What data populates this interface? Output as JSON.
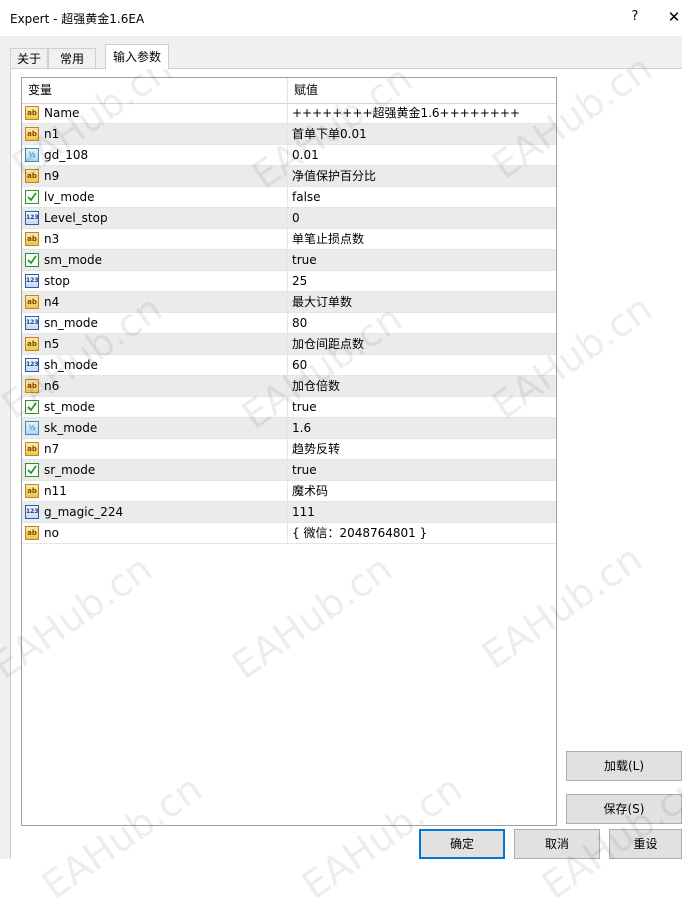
{
  "window": {
    "title": "Expert - 超强黄金1.6EA",
    "help_label": "?",
    "close_label": "✕"
  },
  "tabs": [
    {
      "label": "关于",
      "active": false
    },
    {
      "label": "常用",
      "active": false
    },
    {
      "label": "输入参数",
      "active": true
    }
  ],
  "grid": {
    "header_var": "变量",
    "header_val": "赋值",
    "rows": [
      {
        "type": "ab",
        "name": "Name",
        "value": "++++++++超强黄金1.6++++++++"
      },
      {
        "type": "ab",
        "name": "n1",
        "value": "首单下单0.01"
      },
      {
        "type": "dbl",
        "name": "gd_108",
        "value": "0.01"
      },
      {
        "type": "ab",
        "name": "n9",
        "value": "净值保护百分比"
      },
      {
        "type": "bool",
        "name": "lv_mode",
        "value": "false"
      },
      {
        "type": "num",
        "name": "Level_stop",
        "value": "0"
      },
      {
        "type": "ab",
        "name": "n3",
        "value": "单笔止损点数"
      },
      {
        "type": "bool",
        "name": "sm_mode",
        "value": "true"
      },
      {
        "type": "num",
        "name": "stop",
        "value": "25"
      },
      {
        "type": "ab",
        "name": "n4",
        "value": "最大订单数"
      },
      {
        "type": "num",
        "name": "sn_mode",
        "value": "80"
      },
      {
        "type": "ab",
        "name": "n5",
        "value": "加仓间距点数"
      },
      {
        "type": "num",
        "name": "sh_mode",
        "value": "60"
      },
      {
        "type": "ab",
        "name": "n6",
        "value": "加仓倍数"
      },
      {
        "type": "bool",
        "name": "st_mode",
        "value": "true"
      },
      {
        "type": "dbl",
        "name": "sk_mode",
        "value": "1.6"
      },
      {
        "type": "ab",
        "name": "n7",
        "value": "趋势反转"
      },
      {
        "type": "bool",
        "name": "sr_mode",
        "value": "true"
      },
      {
        "type": "ab",
        "name": "n11",
        "value": "魔术码"
      },
      {
        "type": "num",
        "name": "g_magic_224",
        "value": "111"
      },
      {
        "type": "ab",
        "name": "no",
        "value": "{ 微信：2048764801 }"
      }
    ]
  },
  "icons": {
    "ab": "ab",
    "dbl": "½",
    "num": "123"
  },
  "buttons": {
    "load": "加载(L)",
    "save": "保存(S)",
    "ok": "确定",
    "cancel": "取消",
    "reset": "重设"
  },
  "watermark": "EAHub.cn",
  "colors": {
    "accent": "#0078d7",
    "row_alt": "#ebebeb",
    "dialog_bg": "#f0f0f0"
  }
}
